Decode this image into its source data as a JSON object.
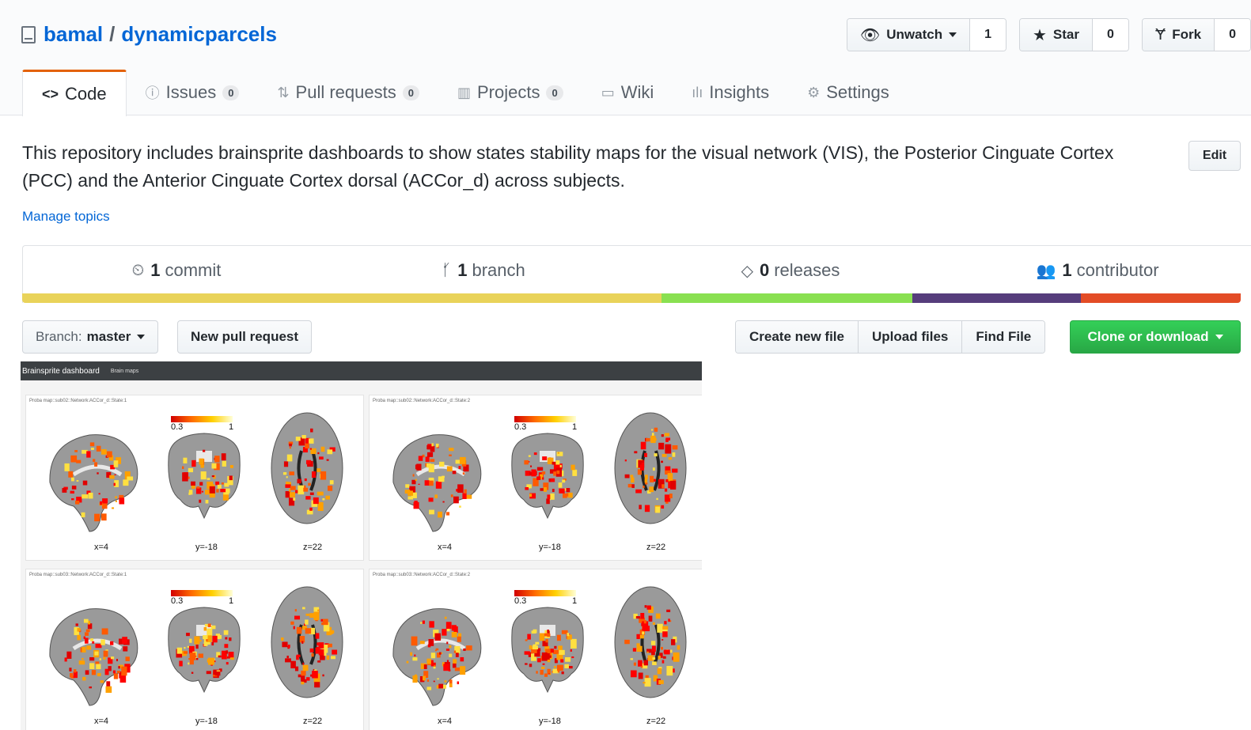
{
  "repo": {
    "owner": "bamal",
    "separator": "/",
    "name": "dynamicparcels"
  },
  "actions": {
    "watch": {
      "label": "Unwatch",
      "count": "1"
    },
    "star": {
      "label": "Star",
      "count": "0"
    },
    "fork": {
      "label": "Fork",
      "count": "0"
    }
  },
  "tabs": [
    {
      "label": "Code",
      "icon": "code-icon"
    },
    {
      "label": "Issues",
      "count": "0",
      "icon": "issue-icon"
    },
    {
      "label": "Pull requests",
      "count": "0",
      "icon": "pull-request-icon"
    },
    {
      "label": "Projects",
      "count": "0",
      "icon": "project-icon"
    },
    {
      "label": "Wiki",
      "icon": "book-icon"
    },
    {
      "label": "Insights",
      "icon": "graph-icon"
    },
    {
      "label": "Settings",
      "icon": "gear-icon"
    }
  ],
  "description": "This repository includes brainsprite dashboards to show states stability maps for the visual network (VIS), the Posterior Cinguate Cortex (PCC) and the Anterior Cinguate Cortex dorsal (ACCor_d) across subjects.",
  "edit_label": "Edit",
  "manage_topics": "Manage topics",
  "summary": [
    {
      "count": "1",
      "label": "commit",
      "icon": "history-icon"
    },
    {
      "count": "1",
      "label": "branch",
      "icon": "branch-icon"
    },
    {
      "count": "0",
      "label": "releases",
      "icon": "tag-icon"
    },
    {
      "count": "1",
      "label": "contributor",
      "icon": "people-icon"
    }
  ],
  "languages": [
    {
      "color": "#e9d35a",
      "share": 0.5245
    },
    {
      "color": "#89e051",
      "share": 0.2061
    },
    {
      "color": "#563d7c",
      "share": 0.1384
    },
    {
      "color": "#e34c26",
      "share": 0.131
    }
  ],
  "branch": {
    "prefix": "Branch:",
    "name": "master"
  },
  "new_pr": "New pull request",
  "file_actions": [
    "Create new file",
    "Upload files",
    "Find File"
  ],
  "clone": "Clone or download",
  "dashboard": {
    "nav_title": "Brainsprite dashboard",
    "nav_sub": "Brain maps",
    "panels": [
      {
        "title": "Proba map::sub02::Network:ACCor_d::State:1",
        "cmin": "0.3",
        "cmax": "1",
        "coords": [
          "x=4",
          "y=-18",
          "z=22"
        ]
      },
      {
        "title": "Proba map::sub02::Network:ACCor_d::State:2",
        "cmin": "0.3",
        "cmax": "1",
        "coords": [
          "x=4",
          "y=-18",
          "z=22"
        ]
      },
      {
        "title": "Proba map::sub03::Network:ACCor_d::State:1",
        "cmin": "0.3",
        "cmax": "1",
        "coords": [
          "x=4",
          "y=-18",
          "z=22"
        ]
      },
      {
        "title": "Proba map::sub03::Network:ACCor_d::State:2",
        "cmin": "0.3",
        "cmax": "1",
        "coords": [
          "x=4",
          "y=-18",
          "z=22"
        ]
      }
    ]
  }
}
